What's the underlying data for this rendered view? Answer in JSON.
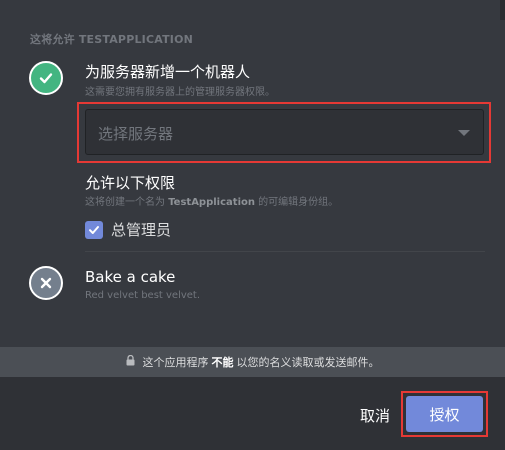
{
  "header": {
    "section_label": "这将允许 TESTAPPLICATION"
  },
  "permissions": [
    {
      "title": "为服务器新增一个机器人",
      "subtitle": "这需要您拥有服务器上的管理服务器权限。",
      "granted": true,
      "icon": "check-icon"
    },
    {
      "title": "Bake a cake",
      "subtitle": "Red velvet best velvet.",
      "granted": false,
      "icon": "x-icon"
    }
  ],
  "server_select": {
    "placeholder": "选择服务器"
  },
  "allow_permissions": {
    "title": "允许以下权限",
    "subtitle_prefix": "这将创建一个名为",
    "subtitle_app": "TestApplication",
    "subtitle_suffix": "的可编辑身份组。",
    "admin_label": "总管理员",
    "admin_checked": true
  },
  "notice": {
    "prefix": "这个应用程序",
    "emphasis": "不能",
    "suffix": "以您的名义读取或发送邮件。",
    "icon": "lock-icon"
  },
  "footer": {
    "cancel_label": "取消",
    "authorize_label": "授权"
  },
  "colors": {
    "accent": "#7289da",
    "granted": "#43b581",
    "denied": "#747f8d",
    "highlight": "#e53935"
  }
}
